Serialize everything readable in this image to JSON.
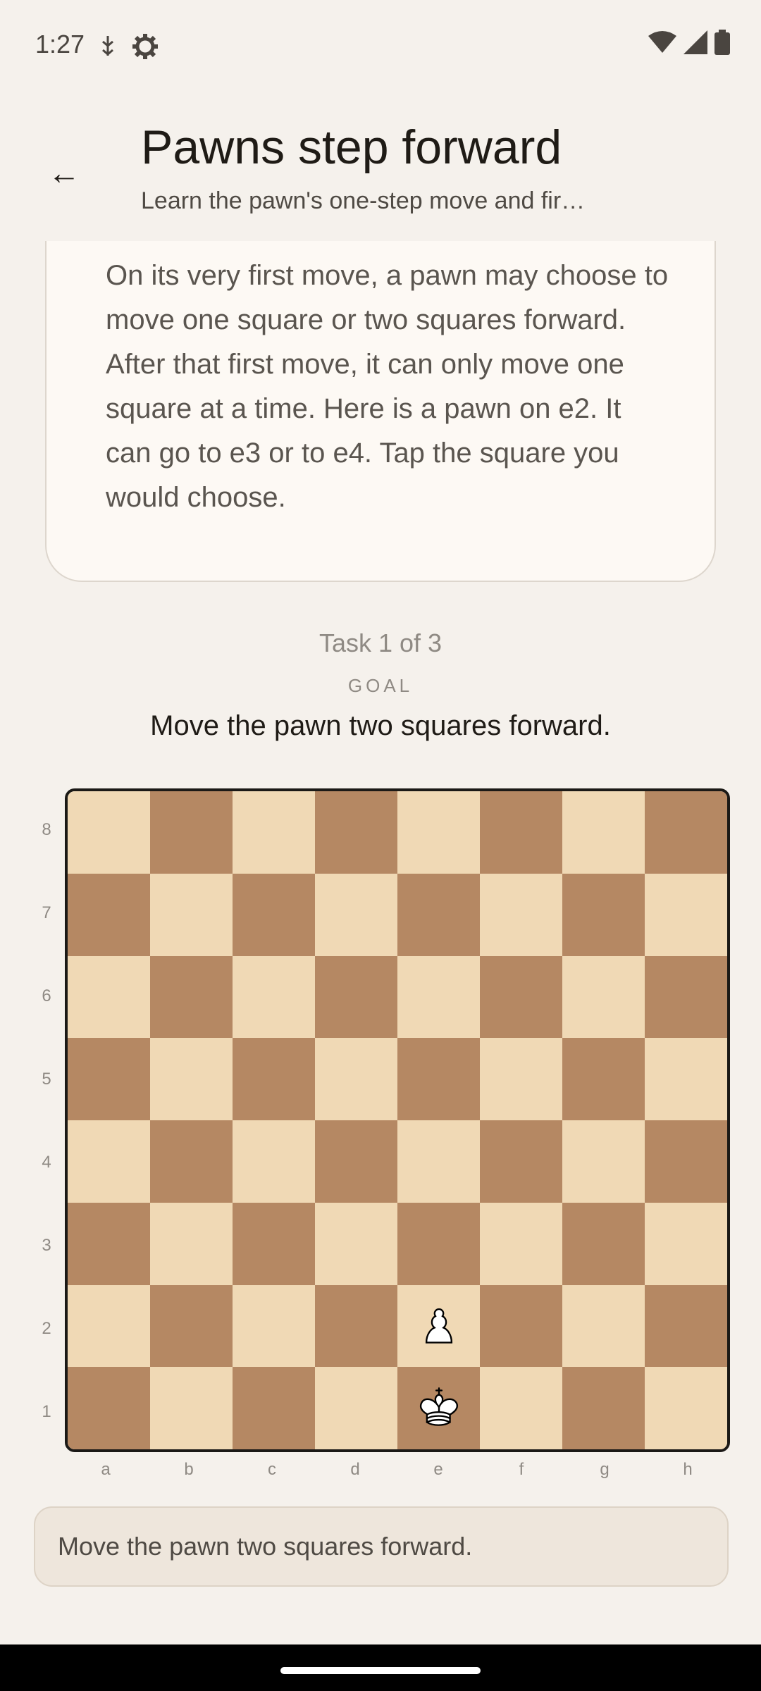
{
  "status_bar": {
    "time": "1:27",
    "left_icons": [
      "usb-debug-icon",
      "settings-gear-icon"
    ],
    "right_icons": [
      "wifi-icon",
      "cell-signal-icon",
      "battery-icon"
    ]
  },
  "app_bar": {
    "back_glyph": "←",
    "title": "Pawns step forward",
    "subtitle": "Learn the pawn's one-step move and fir…"
  },
  "lesson": {
    "text": "On its very first move, a pawn may choose to move one square or two squares forward. After that first move, it can only move one square at a time. Here is a pawn on e2. It can go to e3 or to e4. Tap the square you would choose."
  },
  "task": {
    "counter": "Task 1 of 3",
    "goal_label": "GOAL",
    "goal_text": "Move the pawn two squares forward."
  },
  "board": {
    "files": [
      "a",
      "b",
      "c",
      "d",
      "e",
      "f",
      "g",
      "h"
    ],
    "ranks": [
      "8",
      "7",
      "6",
      "5",
      "4",
      "3",
      "2",
      "1"
    ],
    "pieces": [
      {
        "square": "e2",
        "piece": "white-pawn"
      },
      {
        "square": "e1",
        "piece": "white-king"
      }
    ],
    "colors": {
      "light": "#f0d9b5",
      "dark": "#b58863"
    }
  },
  "feedback": {
    "message": "Move the pawn two squares forward."
  }
}
